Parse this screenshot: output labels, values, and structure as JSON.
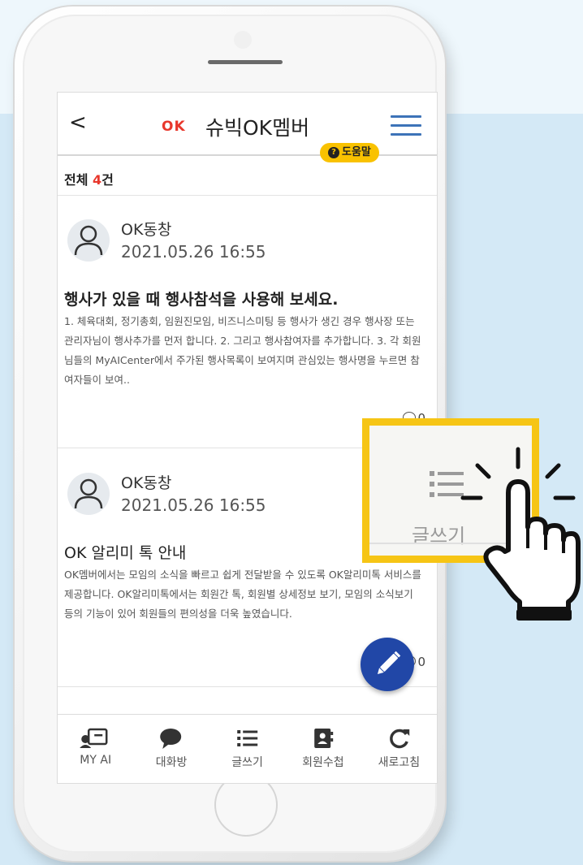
{
  "app": {
    "back_label": "<",
    "logo_text": "OK",
    "title": "슈빅OK멤버",
    "help_label": "도움말"
  },
  "list": {
    "total_label": "전체",
    "total_count": "4",
    "count_suffix": "건"
  },
  "posts": [
    {
      "author": "OK동창",
      "date": "2021.05.26 16:55",
      "title": "행사가 있을 때 행사참석을 사용해 보세요.",
      "body": "1. 체육대회, 정기총회, 임원진모임, 비즈니스미팅 등 행사가 생긴 경우 행사장 또는 관리자님이 행사추가를 먼저 합니다. 2. 그리고 행사참여자를 추가합니다. 3. 각 회원님들의 MyAICenter에서 주가된 행사목록이 보여지며 관심있는 행사명을 누르면 참여자들이 보여..",
      "comment_count": "0"
    },
    {
      "author": "OK동창",
      "date": "2021.05.26 16:55",
      "title": "OK 알리미 톡 안내",
      "body": "OK멤버에서는 모임의 소식을 빠르고 쉽게 전달받을 수 있도록 OK알리미톡 서비스를 제공합니다. OK알리미톡에서는 회원간 톡, 회원별 상세정보 보기, 모임의 소식보기 등의 기능이 있어 회원들의 편의성을 더욱 높였습니다.",
      "comment_count": "0"
    }
  ],
  "bottom_nav": [
    {
      "label": "MY AI",
      "icon": "profile-card-icon"
    },
    {
      "label": "대화방",
      "icon": "chat-bubble-icon"
    },
    {
      "label": "글쓰기",
      "icon": "list-icon"
    },
    {
      "label": "회원수첩",
      "icon": "contact-book-icon"
    },
    {
      "label": "새로고침",
      "icon": "refresh-icon"
    }
  ],
  "callout": {
    "label": "글쓰기",
    "icon": "list-icon"
  },
  "colors": {
    "accent_red": "#e8372c",
    "menu_blue": "#3d73b8",
    "badge_yellow": "#f9c200",
    "fab_blue": "#2147a7",
    "callout_border": "#f6c515",
    "background": "#d4e9f6"
  }
}
